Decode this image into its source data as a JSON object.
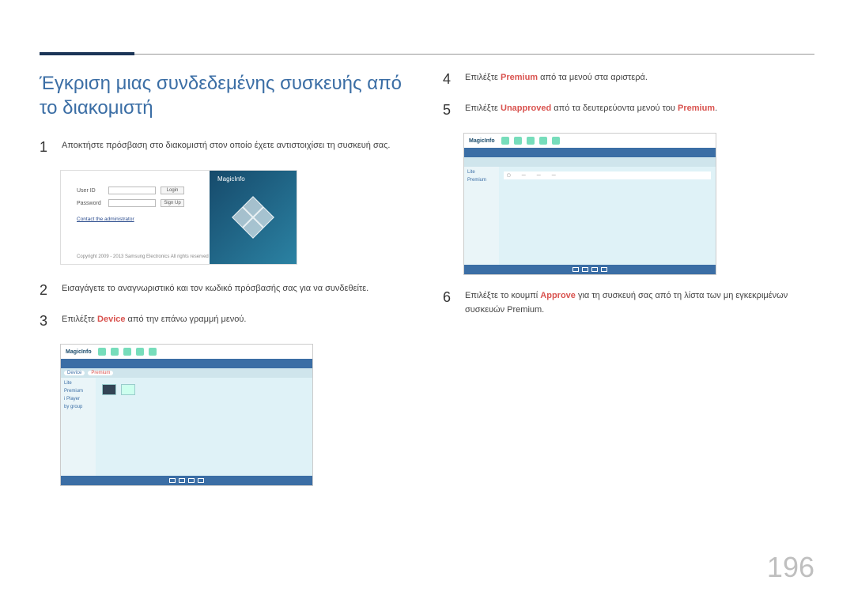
{
  "page_number": "196",
  "title": "Έγκριση μιας συνδεδεμένης συσκευής από το διακομιστή",
  "steps": {
    "s1": {
      "num": "1",
      "text": "Αποκτήστε πρόσβαση στο διακομιστή στον οποίο έχετε αντιστοιχίσει τη συσκευή σας."
    },
    "s2": {
      "num": "2",
      "text": "Εισαγάγετε το αναγνωριστικό και τον κωδικό πρόσβασής σας για να συνδεθείτε."
    },
    "s3": {
      "num": "3",
      "pre": "Επιλέξτε ",
      "kw": "Device",
      "post": " από την επάνω γραμμή μενού."
    },
    "s4": {
      "num": "4",
      "pre": "Επιλέξτε ",
      "kw": "Premium",
      "post": " από τα μενού στα αριστερά."
    },
    "s5": {
      "num": "5",
      "pre": "Επιλέξτε ",
      "kw": "Unapproved",
      "post_a": " από τα δευτερεύοντα μενού του ",
      "kw2": "Premium",
      "post_b": "."
    },
    "s6": {
      "num": "6",
      "pre": "Επιλέξτε το κουμπί ",
      "kw": "Approve",
      "post": " για τη συσκευή σας από τη λίστα των μη εγκεκριμένων συσκευών Premium."
    }
  },
  "login": {
    "user_label": "User ID",
    "pass_label": "Password",
    "login_btn": "Login",
    "signup_btn": "Sign Up",
    "contact": "Contact the administrator",
    "copyright": "Copyright 2009 - 2013 Samsung Electronics All rights reserved",
    "brand": "MagicInfo"
  },
  "app": {
    "brand": "MagicInfo",
    "side_items": [
      "Lite",
      "Premium",
      "i Player",
      "by group"
    ],
    "chips": {
      "normal": "Device",
      "highlight": "Premium"
    }
  }
}
